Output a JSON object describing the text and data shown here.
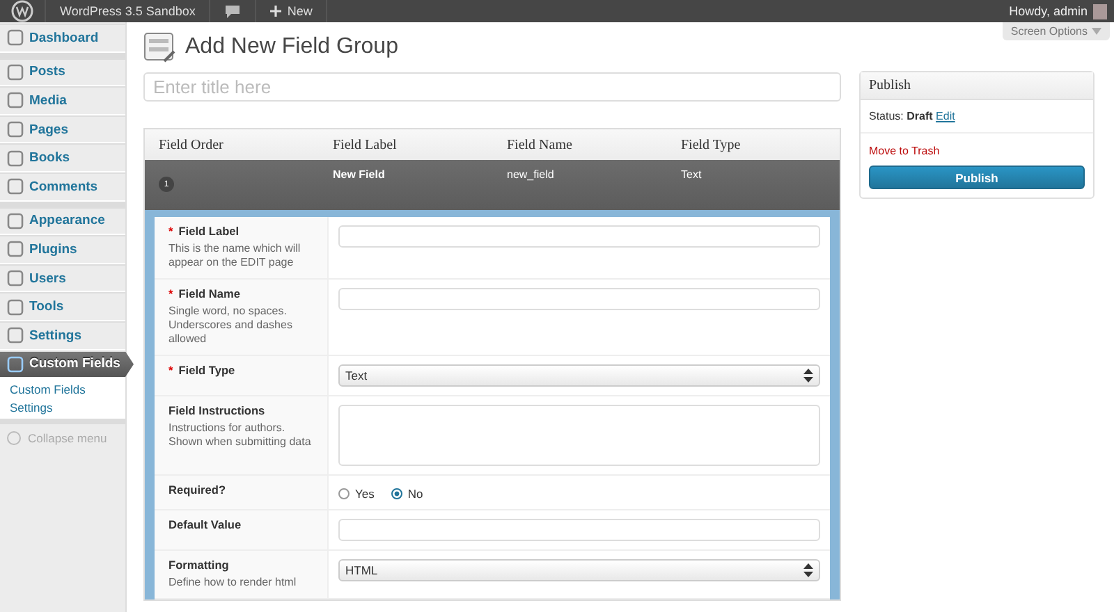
{
  "admin_bar": {
    "site": "WordPress 3.5 Sandbox",
    "new": "New",
    "greeting": "Howdy, admin"
  },
  "sidebar": {
    "groups": [
      [
        {
          "label": "Dashboard",
          "selected": false
        }
      ],
      [
        {
          "label": "Posts",
          "selected": false
        },
        {
          "label": "Media",
          "selected": false
        },
        {
          "label": "Pages",
          "selected": false
        },
        {
          "label": "Books",
          "selected": false
        },
        {
          "label": "Comments",
          "selected": false
        }
      ],
      [
        {
          "label": "Appearance",
          "selected": false
        },
        {
          "label": "Plugins",
          "selected": false
        },
        {
          "label": "Users",
          "selected": false
        },
        {
          "label": "Tools",
          "selected": false
        },
        {
          "label": "Settings",
          "selected": false
        },
        {
          "label": "Custom Fields",
          "selected": true,
          "children": [
            {
              "label": "Custom Fields"
            },
            {
              "label": "Settings"
            }
          ]
        }
      ]
    ],
    "collapse": "Collapse menu"
  },
  "screen_options": "Screen Options",
  "page_title": "Add New Field Group",
  "title_field": {
    "placeholder": "Enter title here"
  },
  "fields_table": {
    "columns": [
      "Field Order",
      "Field Label",
      "Field Name",
      "Field Type"
    ],
    "rows": [
      {
        "order": "1",
        "label": "New Field",
        "name": "new_field",
        "type": "Text"
      }
    ]
  },
  "field_settings": [
    {
      "kind": "text",
      "mark": "*",
      "label": "Field Label",
      "description": "This is the name which will appear on the EDIT page"
    },
    {
      "kind": "text",
      "mark": "*",
      "label": "Field Name",
      "description": "Single word, no spaces. Underscores and dashes allowed"
    },
    {
      "kind": "select",
      "mark": "*",
      "label": "Field Type",
      "value": "Text"
    },
    {
      "kind": "textarea",
      "label": "Field Instructions",
      "description": "Instructions for authors. Shown when submitting data"
    },
    {
      "kind": "radio",
      "label": "Required?",
      "options": [
        {
          "label": "Yes",
          "selected": false
        },
        {
          "label": "No",
          "selected": true
        }
      ]
    },
    {
      "kind": "text",
      "label": "Default Value"
    },
    {
      "kind": "select",
      "label": "Formatting",
      "description": "Define how to render html",
      "value": "HTML"
    }
  ],
  "publish": {
    "title": "Publish",
    "status_label": "Status:",
    "status": "Draft",
    "edit": "Edit",
    "trash": "Move to Trash",
    "button": "Publish"
  }
}
